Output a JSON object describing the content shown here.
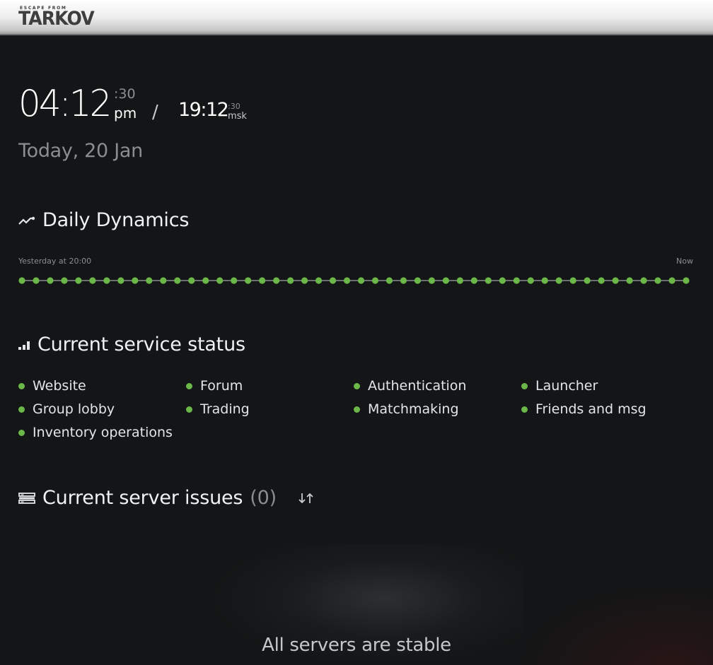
{
  "header": {
    "logo_small": "ESCAPE FROM",
    "logo_big": "TARKOV"
  },
  "clock": {
    "local_time": "04:12",
    "local_seconds": ":30",
    "ampm": "pm",
    "separator": "/",
    "msk_time": "19:12",
    "msk_seconds": ":30",
    "msk_label": "msk",
    "date": "Today, 20 Jan"
  },
  "dynamics": {
    "title": "Daily Dynamics",
    "icon": "trend-line-icon",
    "start_label": "Yesterday at 20:00",
    "end_label": "Now",
    "point_count": 48,
    "status_color": "#6bb849",
    "line_color": "#6b6f70"
  },
  "services": {
    "title": "Current service status",
    "icon": "signal-bars-icon",
    "status_color": "#6bb849",
    "items": [
      {
        "label": "Website"
      },
      {
        "label": "Forum"
      },
      {
        "label": "Authentication"
      },
      {
        "label": "Launcher"
      },
      {
        "label": "Group lobby"
      },
      {
        "label": "Trading"
      },
      {
        "label": "Matchmaking"
      },
      {
        "label": "Friends and msg"
      },
      {
        "label": "Inventory operations"
      }
    ]
  },
  "issues": {
    "title": "Current server issues",
    "count": "(0)",
    "icon": "server-list-icon",
    "sort_icon": "sort-arrows-icon",
    "empty_message": "All servers are stable"
  }
}
